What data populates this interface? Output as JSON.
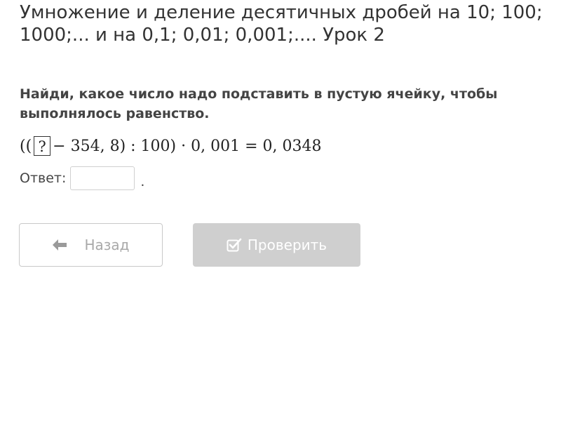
{
  "lesson": {
    "title": "Умножение и деление десятичных дробей на 10; 100; 1000;... и на 0,1; 0,01; 0,001;.... Урок 2"
  },
  "task": {
    "instruction": "Найди, какое число надо подставить в пустую ячейку, чтобы выполнялось равенство.",
    "equation_prefix": "((",
    "placeholder": "?",
    "equation_suffix": "− 354, 8) : 100) · 0, 001 = 0, 0348"
  },
  "answer": {
    "label": "Ответ:",
    "value": "",
    "trailing": "."
  },
  "buttons": {
    "back_label": "Назад",
    "check_label": "Проверить"
  },
  "colors": {
    "disabled_button_bg": "#cfcfcf",
    "back_button_text": "#a9a9a9",
    "text": "#333333"
  },
  "icons": {
    "back": "arrow-left-icon",
    "check": "checkbox-check-icon"
  }
}
